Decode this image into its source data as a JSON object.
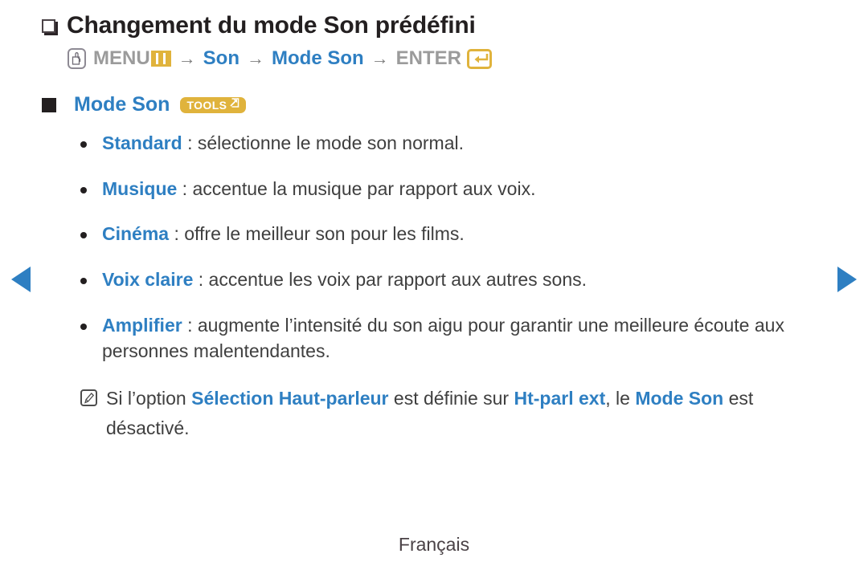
{
  "colors": {
    "accent_blue": "#2e7fc2",
    "gold": "#e0b33c",
    "gray_text": "#9b9b9b",
    "body_text": "#3f3f3f",
    "title_text": "#231f20"
  },
  "nav": {
    "prev_label": "◀",
    "next_label": "▶",
    "prev_icon": "triangle-left-icon",
    "next_icon": "triangle-right-icon"
  },
  "heading": {
    "marker_icon": "outlined-square-icon",
    "text": "Changement du mode Son prédéfini"
  },
  "menu_path": {
    "press_icon": "press-button-icon",
    "menu_label": "MENU",
    "menu_icon": "menu-bars-icon",
    "arrow": "→",
    "step_son": "Son",
    "step_mode_son": "Mode Son",
    "enter_label": "ENTER",
    "enter_icon": "enter-return-icon"
  },
  "section": {
    "marker_icon": "filled-square-icon",
    "title": "Mode Son",
    "badge_label": "TOOLS",
    "badge_icon": "tools-arrow-icon"
  },
  "bullets": [
    {
      "marker_icon": "bullet-dot-icon",
      "keyword": "Standard",
      "separator": " : ",
      "description": "sélectionne le mode son normal."
    },
    {
      "marker_icon": "bullet-dot-icon",
      "keyword": "Musique",
      "separator": " : ",
      "description": "accentue la musique par rapport aux voix."
    },
    {
      "marker_icon": "bullet-dot-icon",
      "keyword": "Cinéma",
      "separator": " : ",
      "description": "offre le meilleur son pour les films."
    },
    {
      "marker_icon": "bullet-dot-icon",
      "keyword": "Voix claire",
      "separator": " : ",
      "description": "accentue les voix par rapport aux autres sons."
    },
    {
      "marker_icon": "bullet-dot-icon",
      "keyword": "Amplifier",
      "separator": " : ",
      "description": "augmente l’intensité du son aigu pour garantir une meilleure écoute aux personnes malentendantes."
    }
  ],
  "note": {
    "icon": "note-pencil-icon",
    "part1": "Si l’option ",
    "kw1": "Sélection Haut-parleur",
    "part2": " est définie sur ",
    "kw2": "Ht-parl ext",
    "part3": ", le ",
    "kw3": "Mode Son",
    "part4": " est désactivé."
  },
  "footer": {
    "language": "Français"
  }
}
